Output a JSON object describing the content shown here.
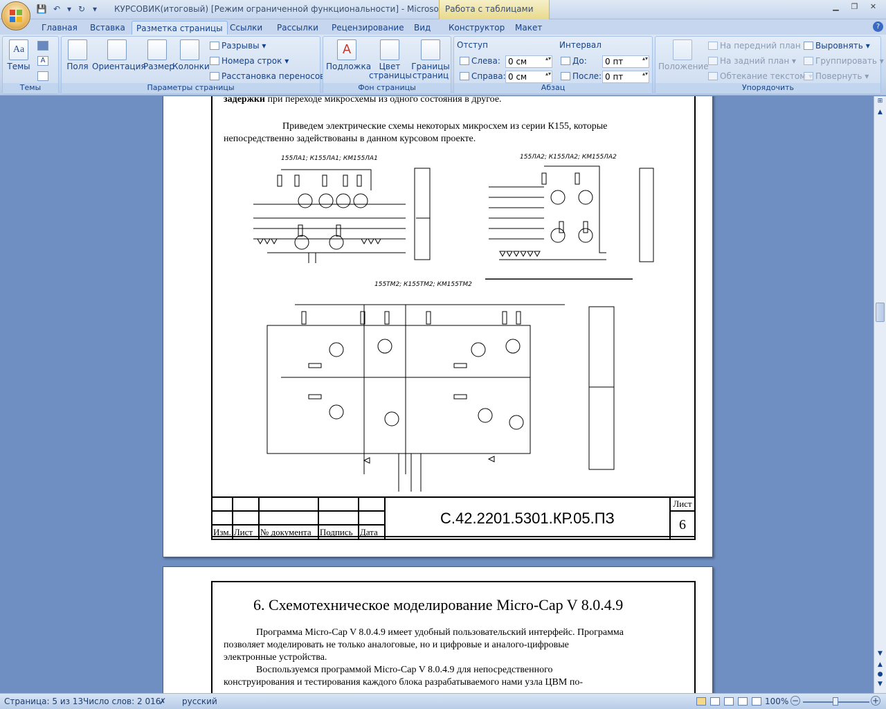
{
  "window": {
    "title": "КУРСОВИК(итоговый) [Режим ограниченной функциональности] - Microsoft Wo...",
    "context_tab": "Работа с таблицами"
  },
  "tabs": [
    {
      "label": "Главная"
    },
    {
      "label": "Вставка"
    },
    {
      "label": "Разметка страницы"
    },
    {
      "label": "Ссылки"
    },
    {
      "label": "Рассылки"
    },
    {
      "label": "Рецензирование"
    },
    {
      "label": "Вид"
    },
    {
      "label": "Конструктор"
    },
    {
      "label": "Макет"
    }
  ],
  "ribbon": {
    "themes": {
      "label": "Темы",
      "btn": "Темы"
    },
    "page_setup": {
      "label": "Параметры страницы",
      "fields": "Поля",
      "orientation": "Ориентация",
      "size": "Размер",
      "columns": "Колонки",
      "breaks": "Разрывы",
      "line_numbers": "Номера строк",
      "hyphenation": "Расстановка переносов"
    },
    "background": {
      "label": "Фон страницы",
      "watermark": "Подложка",
      "page_color_1": "Цвет",
      "page_color_2": "страницы",
      "borders_1": "Границы",
      "borders_2": "страниц"
    },
    "paragraph": {
      "label": "Абзац",
      "indent": "Отступ",
      "left": "Слева:",
      "right": "Справа:",
      "left_val": "0 см",
      "right_val": "0 см",
      "spacing": "Интервал",
      "before": "До:",
      "after": "После:",
      "before_val": "0 пт",
      "after_val": "0 пт"
    },
    "arrange": {
      "label": "Упорядочить",
      "position": "Положение",
      "front": "На передний план",
      "back": "На задний план",
      "wrap": "Обтекание текстом",
      "align": "Выровнять",
      "group": "Группировать",
      "rotate": "Повернуть"
    }
  },
  "page1": {
    "top_line_bold": "задержки",
    "top_line_rest": " при переходе микросхемы из одного состояния в другое.",
    "para1_line1": "Приведем электрические схемы некоторых микросхем из серии К155, которые",
    "para1_line2": "непосредственно задействованы в данном курсовом проекте.",
    "schematic_labels": {
      "la1": "155ЛА1; К155ЛА1; КМ155ЛА1",
      "la2": "155ЛА2; К155ЛА2; КМ155ЛА2",
      "tm2": "155ТМ2; К155ТМ2; КМ155ТМ2"
    },
    "stamp": {
      "sheet_label": "Лист",
      "sheet_num": "6",
      "code": "С.42.2201.5301.КР.05.ПЗ",
      "cols": [
        "Изм.",
        "Лист",
        "№ документа",
        "Подпись",
        "Дата"
      ]
    }
  },
  "page2": {
    "heading": "6. Схемотехническое моделирование  Micro-Cap V 8.0.4.9",
    "p1_l1": "Программа Micro-Cap V 8.0.4.9 имеет удобный пользовательский интерфейс. Программа",
    "p1_l2": "позволяет моделировать не только аналоговые, но и цифровые и аналого-цифровые",
    "p1_l3": "электронные устройства.",
    "p2_l1": "Воспользуемся программой Micro-Cap V 8.0.4.9  для непосредственного",
    "p2_l2": "конструирования  и тестирования каждого блока разрабатываемого нами  узла ЦВМ по-"
  },
  "status": {
    "page": "Страница: 5 из 13",
    "words": "Число слов: 2 016",
    "lang": "русский",
    "zoom": "100%"
  }
}
